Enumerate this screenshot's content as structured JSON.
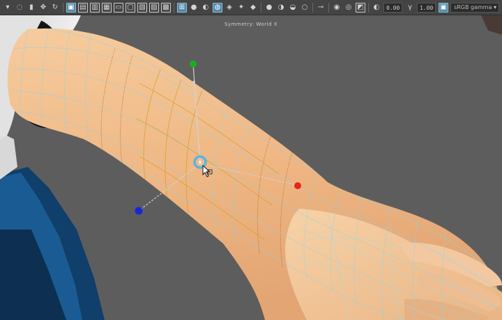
{
  "toolbar": {
    "fields": {
      "camera_near": "0.00",
      "camera_far": "1.00"
    },
    "color_space": "sRGB gamma",
    "icons": [
      "select-icon",
      "lasso-icon",
      "paint-select-icon",
      "move-icon",
      "rotate-icon",
      "camera-attributes-icon",
      "bookmark-icon",
      "image-plane-icon",
      "grid-icon",
      "film-gate-icon",
      "resolution-gate-icon",
      "gate-mask-icon",
      "field-chart-icon",
      "safe-action-icon",
      "safe-title-icon",
      "wireframe-icon",
      "smooth-shade-icon",
      "default-material-icon",
      "wireframe-on-shaded-icon",
      "textured-icon",
      "lighting-icon",
      "shadows-icon",
      "ambient-occlusion-icon",
      "motion-blur-icon",
      "anti-aliasing-icon",
      "depth-of-field-icon",
      "isolate-select-icon",
      "xray-icon",
      "xray-joints-icon",
      "backface-culling-icon",
      "exposure-icon",
      "gamma-icon"
    ]
  },
  "viewport": {
    "label": "Symmetry: World X",
    "colors": {
      "background": "#5d5d5d",
      "skin": "#f2bc8d",
      "wire": "#8fd3e8",
      "selected_edge": "#d8a02a",
      "axis_x": "#e8261a",
      "axis_y": "#17b01c",
      "axis_z": "#1627d8",
      "pivot": "#5ab4e0"
    }
  }
}
